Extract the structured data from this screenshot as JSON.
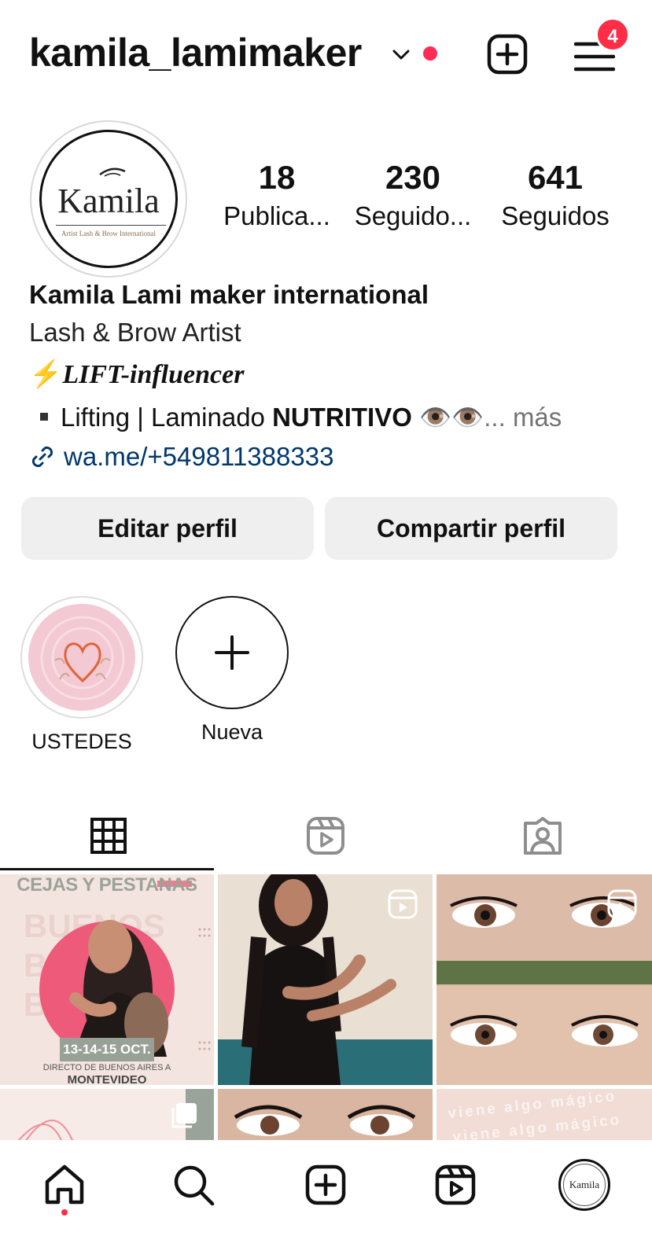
{
  "header": {
    "username": "kamila_lamimaker",
    "notification_count": "4"
  },
  "profile": {
    "avatar_logo": "Kamila",
    "avatar_sub": "Artist Lash & Brow International",
    "stats": [
      {
        "number": "18",
        "label": "Publica..."
      },
      {
        "number": "230",
        "label": "Seguido..."
      },
      {
        "number": "641",
        "label": "Seguidos"
      }
    ],
    "name": "Kamila Lami maker international",
    "category": "Lash & Brow Artist",
    "bio_lift_emoji": "⚡",
    "bio_lift": "LIFT-influencer",
    "bio_line_prefix": "Lifting | Laminado ",
    "bio_line_bold": "NUTRITIVO",
    "bio_line_emojis": "👁️👁️",
    "bio_more": "... más",
    "link": "wa.me/+549811388333"
  },
  "buttons": {
    "edit": "Editar perfil",
    "share": "Compartir perfil"
  },
  "highlights": [
    {
      "label": "USTEDES"
    },
    {
      "label": "Nueva"
    }
  ],
  "tabs": [
    "grid-icon",
    "reels-icon",
    "tagged-icon"
  ],
  "grid_post1": {
    "title": "CEJAS Y PESTANAS",
    "dates": "13-14-15 OCT.",
    "subtitle": "DIRECTO DE BUENOS AIRES A",
    "city": "MONTEVIDEO"
  },
  "grid_post_magic": "viene algo mágico",
  "colors": {
    "accent_red": "#ff2d46",
    "link_blue": "#00376b",
    "button_gray": "#efefef"
  }
}
